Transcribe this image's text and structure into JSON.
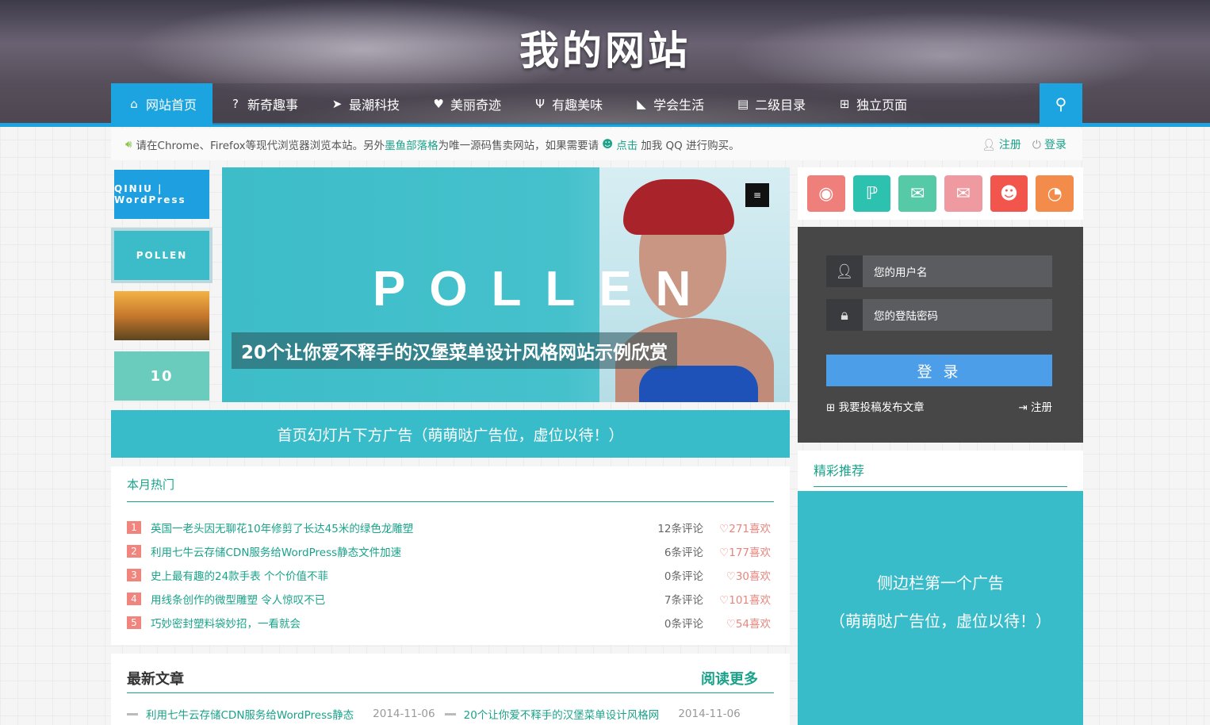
{
  "site": {
    "title": "我的网站"
  },
  "nav": {
    "items": [
      {
        "label": "网站首页",
        "icon": "home-icon",
        "glyph": "⌂"
      },
      {
        "label": "新奇趣事",
        "icon": "question-icon",
        "glyph": "?"
      },
      {
        "label": "最潮科技",
        "icon": "paper-plane-icon",
        "glyph": "➤"
      },
      {
        "label": "美丽奇迹",
        "icon": "heart-icon",
        "glyph": "♥"
      },
      {
        "label": "有趣美味",
        "icon": "fork-knife-icon",
        "glyph": "Ψ"
      },
      {
        "label": "学会生活",
        "icon": "bullhorn-icon",
        "glyph": "◣"
      },
      {
        "label": "二级目录",
        "icon": "document-icon",
        "glyph": "▤"
      },
      {
        "label": "独立页面",
        "icon": "plus-square-icon",
        "glyph": "⊞"
      }
    ],
    "search_glyph": "⚲"
  },
  "notice": {
    "prefix": "请在Chrome、Firefox等现代浏览器浏览本站。另外",
    "link1": "墨鱼部落格",
    "middle": "为唯一源码售卖网站，如果需要请",
    "link2": "点击",
    "suffix": "加我 QQ 进行购买。",
    "register": "注册",
    "login": "登录"
  },
  "slider": {
    "thumbs": [
      "QINIU | WordPress",
      "POLLEN",
      "",
      "10"
    ],
    "brand": "POLLEN",
    "caption": "20个让你爱不释手的汉堡菜单设计风格网站示例欣赏",
    "menu_glyph": "≡"
  },
  "ad_banner": "首页幻灯片下方广告（萌萌哒广告位，虚位以待！）",
  "hot": {
    "heading": "本月热门",
    "rows": [
      {
        "rank": "1",
        "title": "英国一老头因无聊花10年修剪了长达45米的绿色龙雕塑",
        "comments": "12条评论",
        "likes": "♡271喜欢"
      },
      {
        "rank": "2",
        "title": "利用七牛云存储CDN服务给WordPress静态文件加速",
        "comments": "6条评论",
        "likes": "♡177喜欢"
      },
      {
        "rank": "3",
        "title": "史上最有趣的24款手表 个个价值不菲",
        "comments": "0条评论",
        "likes": "♡30喜欢"
      },
      {
        "rank": "4",
        "title": "用线条创作的微型雕塑 令人惊叹不已",
        "comments": "7条评论",
        "likes": "♡101喜欢"
      },
      {
        "rank": "5",
        "title": "巧妙密封塑料袋妙招，一看就会",
        "comments": "0条评论",
        "likes": "♡54喜欢"
      }
    ]
  },
  "newest": {
    "heading": "最新文章",
    "more": "阅读更多",
    "items": [
      {
        "title": "利用七牛云存储CDN服务给WordPress静态",
        "date": "2014-11-06"
      },
      {
        "title": "20个让你爱不释手的汉堡菜单设计风格网",
        "date": "2014-11-06"
      }
    ]
  },
  "social": [
    {
      "icon": "weibo-icon",
      "glyph": "◉",
      "color": "#ef7f7b"
    },
    {
      "icon": "tencent-weibo-icon",
      "glyph": "ℙ",
      "color": "#2dc1b0"
    },
    {
      "icon": "wechat-icon",
      "glyph": "✉",
      "color": "#56c9a6"
    },
    {
      "icon": "email-icon",
      "glyph": "✉",
      "color": "#ef9aa0"
    },
    {
      "icon": "qq-icon",
      "glyph": "☻",
      "color": "#f2554b"
    },
    {
      "icon": "rss-icon",
      "glyph": "◔",
      "color": "#f38b4b"
    }
  ],
  "login": {
    "username_placeholder": "您的用户名",
    "password_placeholder": "您的登陆密码",
    "button": "登 录",
    "submit_article": "我要投稿发布文章",
    "register": "注册"
  },
  "recommend": {
    "heading": "精彩推荐"
  },
  "side_ad": {
    "line1": "侧边栏第一个广告",
    "line2": "（萌萌哒广告位，虚位以待！）"
  },
  "colors": {
    "accent": "#1ba4e0",
    "green": "#1aa38a",
    "teal": "#39bcca"
  }
}
